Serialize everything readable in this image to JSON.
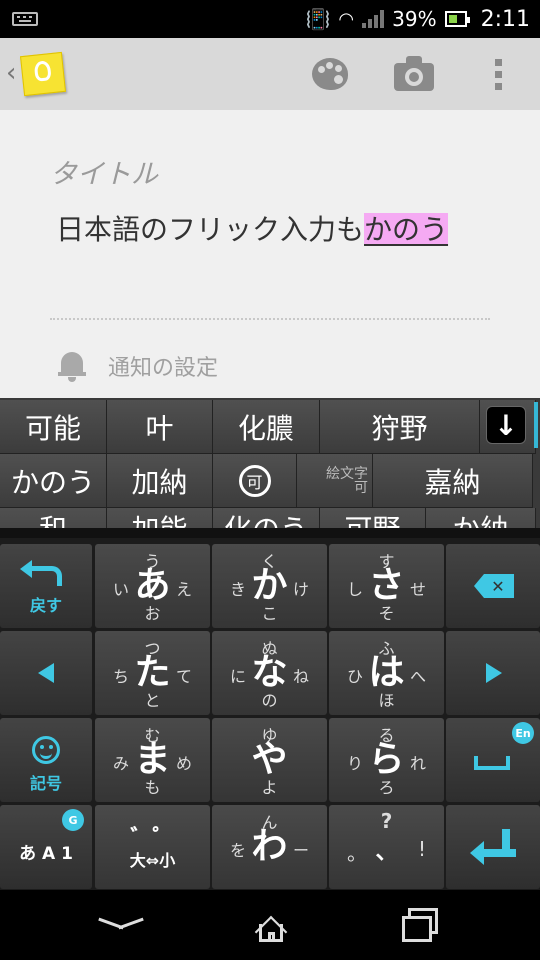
{
  "status_bar": {
    "battery_percent": "39%",
    "time": "2:11",
    "icons": [
      "keyboard-icon",
      "vibrate-icon",
      "wifi-icon",
      "signal-icon",
      "battery-icon"
    ]
  },
  "action_bar": {
    "icons": [
      "back-chevron-icon",
      "keep-app-icon",
      "palette-icon",
      "camera-icon",
      "overflow-menu-icon"
    ]
  },
  "note": {
    "title_placeholder": "タイトル",
    "body_text": "日本語のフリック入力も",
    "composing_text": "かのう",
    "reminder_label": "通知の設定"
  },
  "candidates": {
    "row1": [
      "可能",
      "叶",
      "化膿",
      "狩野"
    ],
    "row2": [
      "かのう",
      "加納",
      "可",
      "嘉納"
    ],
    "row3": [
      "和",
      "加能",
      "化のう",
      "可野",
      "か納"
    ],
    "emoji_label_top": "絵文字",
    "emoji_label_bottom": "可"
  },
  "keyboard": {
    "undo_label": "戻す",
    "symbol_label": "記号",
    "mode_label": "あ A 1",
    "mode_badge": "G",
    "space_badge": "En",
    "keys": {
      "a": {
        "main": "あ",
        "up": "う",
        "left": "い",
        "right": "え",
        "down": "お"
      },
      "ka": {
        "main": "か",
        "up": "く",
        "left": "き",
        "right": "け",
        "down": "こ"
      },
      "sa": {
        "main": "さ",
        "up": "す",
        "left": "し",
        "right": "せ",
        "down": "そ"
      },
      "ta": {
        "main": "た",
        "up": "つ",
        "left": "ち",
        "right": "て",
        "down": "と"
      },
      "na": {
        "main": "な",
        "up": "ぬ",
        "left": "に",
        "right": "ね",
        "down": "の"
      },
      "ha": {
        "main": "は",
        "up": "ふ",
        "left": "ひ",
        "right": "へ",
        "down": "ほ"
      },
      "ma": {
        "main": "ま",
        "up": "む",
        "left": "み",
        "right": "め",
        "down": "も"
      },
      "ya": {
        "main": "や",
        "up": "ゆ",
        "left": "",
        "right": "",
        "down": "よ"
      },
      "ra": {
        "main": "ら",
        "up": "る",
        "left": "り",
        "right": "れ",
        "down": "ろ"
      },
      "wa": {
        "main": "わ",
        "up": "ん",
        "left": "を",
        "right": "ー",
        "down": ""
      },
      "dakuten": {
        "main": "゛゜",
        "down": "大⇔小"
      },
      "punct": {
        "up": "?",
        "left": "。",
        "main": "、",
        "right": "!"
      }
    }
  },
  "colors": {
    "accent": "#3fc8e4",
    "composing_highlight": "#f5aaf3",
    "note_bg": "#f0f0f0",
    "action_bar_bg": "#d9d9d9"
  }
}
